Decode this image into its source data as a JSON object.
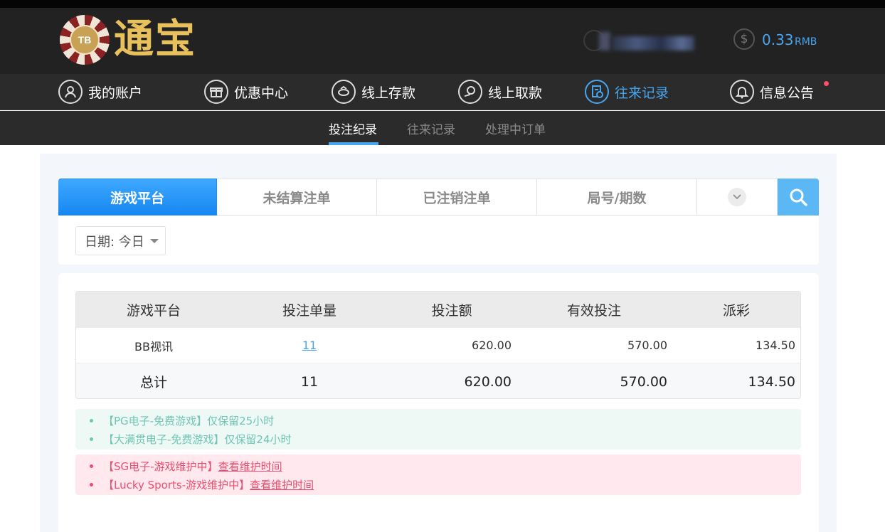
{
  "header": {
    "logo_badge": "TB",
    "logo_title": "通宝",
    "balance_amount": "0.33",
    "balance_unit": "RMB"
  },
  "nav": {
    "items": [
      {
        "label": "我的账户",
        "icon": "user-icon"
      },
      {
        "label": "优惠中心",
        "icon": "gift-icon"
      },
      {
        "label": "线上存款",
        "icon": "deposit-icon"
      },
      {
        "label": "线上取款",
        "icon": "withdraw-icon"
      },
      {
        "label": "往来记录",
        "icon": "records-icon",
        "active": true
      },
      {
        "label": "信息公告",
        "icon": "bell-icon",
        "has_dot": true
      }
    ]
  },
  "subnav": {
    "items": [
      {
        "label": "投注纪录",
        "active": true
      },
      {
        "label": "往来记录"
      },
      {
        "label": "处理中订单"
      }
    ]
  },
  "filters": {
    "tabs": [
      {
        "label": "游戏平台",
        "active": true
      },
      {
        "label": "未结算注单"
      },
      {
        "label": "已注销注单"
      },
      {
        "label": "局号/期数"
      }
    ],
    "more_icon": "chevron-down-icon",
    "search_icon": "search-icon",
    "date_label": "日期: 今日"
  },
  "table": {
    "headers": [
      "游戏平台",
      "投注单量",
      "投注额",
      "有效投注",
      "派彩"
    ],
    "rows": [
      {
        "platform": "BB视讯",
        "count": "11",
        "amount": "620.00",
        "valid": "570.00",
        "payout": "134.50"
      }
    ],
    "total": {
      "label": "总计",
      "count": "11",
      "amount": "620.00",
      "valid": "570.00",
      "payout": "134.50"
    }
  },
  "notices": {
    "info": [
      "【PG电子-免费游戏】仅保留25小时",
      "【大满贯电子-免费游戏】仅保留24小时"
    ],
    "maintenance": [
      {
        "text": "【SG电子-游戏维护中】",
        "link": "查看维护时间"
      },
      {
        "text": "【Lucky Sports-游戏维护中】",
        "link": "查看维护时间"
      }
    ]
  },
  "colors": {
    "accent": "#48a6ee",
    "header_bg": "#222222",
    "nav_bg": "#2b2b2b",
    "notice_green": "#6ec6b4",
    "notice_red": "#ee4d6f"
  }
}
